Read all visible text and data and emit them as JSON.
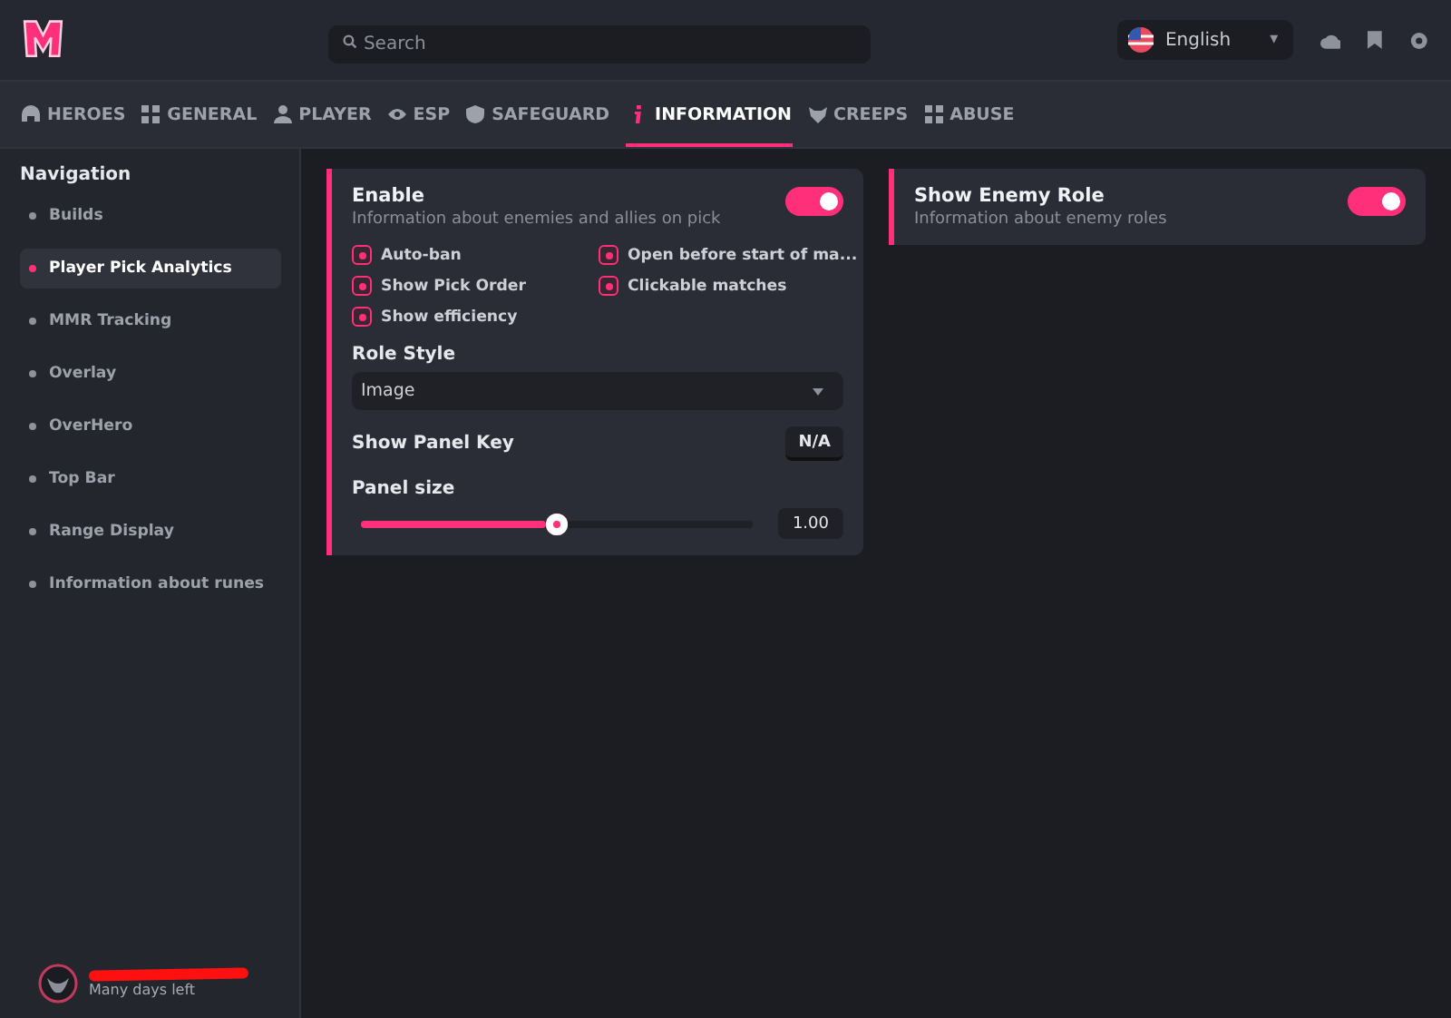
{
  "search": {
    "placeholder": "Search"
  },
  "language": {
    "label": "English",
    "caret": "▾"
  },
  "tabs": [
    {
      "label": "HEROES",
      "selected": false
    },
    {
      "label": "GENERAL",
      "selected": false
    },
    {
      "label": "PLAYER",
      "selected": false
    },
    {
      "label": "ESP",
      "selected": false
    },
    {
      "label": "SAFEGUARD",
      "selected": false
    },
    {
      "label": "INFORMATION",
      "selected": true
    },
    {
      "label": "CREEPS",
      "selected": false
    },
    {
      "label": "ABUSE",
      "selected": false
    }
  ],
  "sidebar": {
    "title": "Navigation",
    "items": [
      {
        "label": "Builds",
        "selected": false
      },
      {
        "label": "Player Pick Analytics",
        "selected": true
      },
      {
        "label": "MMR Tracking",
        "selected": false
      },
      {
        "label": "Overlay",
        "selected": false
      },
      {
        "label": "OverHero",
        "selected": false
      },
      {
        "label": "Top Bar",
        "selected": false
      },
      {
        "label": "Range Display",
        "selected": false
      },
      {
        "label": "Information about runes",
        "selected": false
      }
    ]
  },
  "user": {
    "subscription": "Many days left"
  },
  "panels": [
    {
      "title": "Enable",
      "description": "Information about enemies and allies on pick",
      "on": true,
      "checkboxes": [
        {
          "label": "Auto-ban",
          "checked": true
        },
        {
          "label": "Open before start of ma...",
          "checked": true
        },
        {
          "label": "Show Pick Order",
          "checked": true
        },
        {
          "label": "Clickable matches",
          "checked": true
        },
        {
          "label": "Show efficiency",
          "checked": true
        }
      ],
      "dropdown": {
        "label": "Role Style",
        "value": "Image"
      },
      "key": {
        "label": "Show Panel Key",
        "value": "N/A"
      },
      "slider": {
        "label": "Panel size",
        "level": 0.5,
        "reading": "1.00"
      }
    },
    {
      "title": "Show Enemy Role",
      "description": "Information about enemy roles",
      "on": true
    }
  ]
}
